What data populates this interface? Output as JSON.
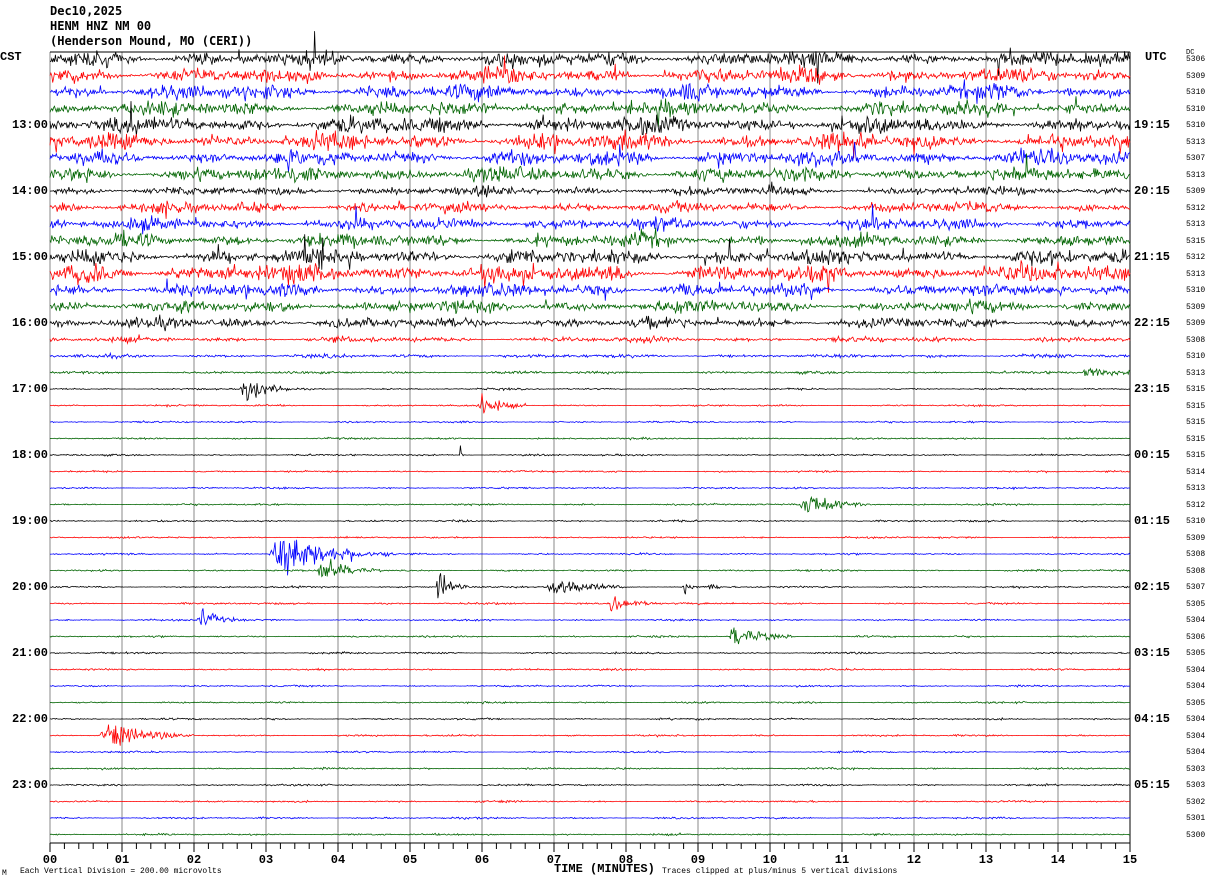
{
  "header": {
    "date": "Dec10,2025",
    "station": "HENM HNZ NM 00",
    "location": "(Henderson Mound, MO (CERI))"
  },
  "left_axis_title": "CST",
  "right_axis_title": "UTC",
  "dc_title": "DC",
  "footer": {
    "scale_note": "Each Vertical Division =  200.00 microvolts",
    "xlabel": "TIME (MINUTES)",
    "clip_note": "Traces clipped at plus/minus 5 vertical divisions",
    "corner_mark": "M"
  },
  "chart_data": {
    "type": "line",
    "subtype": "helicorder",
    "xlabel": "TIME (MINUTES)",
    "xlim": [
      0,
      15
    ],
    "x_ticks": [
      "00",
      "01",
      "02",
      "03",
      "04",
      "05",
      "06",
      "07",
      "08",
      "09",
      "10",
      "11",
      "12",
      "13",
      "14",
      "15"
    ],
    "minutes_per_trace": 15,
    "trace_colors": [
      "#000000",
      "#ff0000",
      "#0000ff",
      "#006400"
    ],
    "grid": true,
    "cst_labels": [
      "13:00",
      "14:00",
      "15:00",
      "16:00",
      "17:00",
      "18:00",
      "19:00",
      "20:00",
      "21:00",
      "22:00",
      "23:00"
    ],
    "utc_labels": [
      "19:15",
      "20:15",
      "21:15",
      "22:15",
      "23:15",
      "00:15",
      "01:15",
      "02:15",
      "03:15",
      "04:15",
      "05:15"
    ],
    "dc_values": [
      "5306",
      "5309",
      "5310",
      "5310",
      "5310",
      "5313",
      "5307",
      "5313",
      "5309",
      "5312",
      "5313",
      "5315",
      "5312",
      "5313",
      "5310",
      "5309",
      "5309",
      "5308",
      "5310",
      "5313",
      "5315",
      "5315",
      "5315",
      "5315",
      "5315",
      "5314",
      "5313",
      "5312",
      "5310",
      "5309",
      "5308",
      "5308",
      "5307",
      "5305",
      "5304",
      "5306",
      "5305",
      "5304",
      "5304",
      "5305",
      "5304",
      "5304",
      "5304",
      "5303",
      "5303",
      "5302",
      "5301",
      "5300"
    ],
    "noise_level": [
      0.5,
      0.5,
      0.5,
      0.5,
      0.55,
      0.55,
      0.5,
      0.5,
      0.3,
      0.35,
      0.4,
      0.45,
      0.5,
      0.6,
      0.45,
      0.4,
      0.35,
      0.18,
      0.12,
      0.09,
      0.06,
      0.06,
      0.06,
      0.06,
      0.06,
      0.06,
      0.06,
      0.06,
      0.06,
      0.06,
      0.06,
      0.06,
      0.06,
      0.06,
      0.06,
      0.06,
      0.06,
      0.06,
      0.06,
      0.06,
      0.06,
      0.06,
      0.06,
      0.06,
      0.06,
      0.06,
      0.06,
      0.06
    ],
    "events": [
      {
        "trace": 19,
        "minute": 14.4,
        "duration": 0.6,
        "amplitude": 0.4
      },
      {
        "trace": 20,
        "minute": 2.7,
        "duration": 0.6,
        "amplitude": 1.0
      },
      {
        "trace": 21,
        "minute": 6.0,
        "duration": 0.6,
        "amplitude": 0.7
      },
      {
        "trace": 24,
        "minute": 5.7,
        "duration": 0.05,
        "amplitude": 0.6
      },
      {
        "trace": 27,
        "minute": 10.5,
        "duration": 0.9,
        "amplitude": 0.8
      },
      {
        "trace": 30,
        "minute": 3.2,
        "duration": 1.6,
        "amplitude": 1.3
      },
      {
        "trace": 31,
        "minute": 3.8,
        "duration": 0.8,
        "amplitude": 0.8
      },
      {
        "trace": 32,
        "minute": 5.4,
        "duration": 0.4,
        "amplitude": 1.0
      },
      {
        "trace": 32,
        "minute": 7.0,
        "duration": 1.0,
        "amplitude": 0.6
      },
      {
        "trace": 32,
        "minute": 8.8,
        "duration": 0.2,
        "amplitude": 0.4
      },
      {
        "trace": 32,
        "minute": 9.15,
        "duration": 0.15,
        "amplitude": 0.5
      },
      {
        "trace": 33,
        "minute": 7.8,
        "duration": 0.7,
        "amplitude": 0.6
      },
      {
        "trace": 34,
        "minute": 2.1,
        "duration": 0.6,
        "amplitude": 0.6
      },
      {
        "trace": 35,
        "minute": 9.5,
        "duration": 0.8,
        "amplitude": 0.8
      },
      {
        "trace": 41,
        "minute": 0.8,
        "duration": 1.2,
        "amplitude": 0.7
      }
    ]
  }
}
